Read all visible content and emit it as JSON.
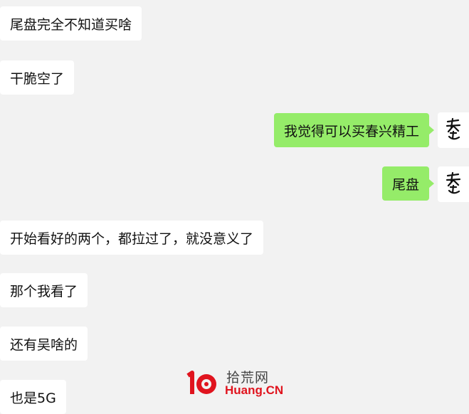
{
  "messages": [
    {
      "side": "left",
      "text": "尾盘完全不知道买啥"
    },
    {
      "side": "left",
      "text": "干脆空了"
    },
    {
      "side": "right",
      "text": "我觉得可以买春兴精工"
    },
    {
      "side": "right",
      "text": "尾盘"
    },
    {
      "side": "left",
      "text": "开始看好的两个，都拉过了，就没意义了"
    },
    {
      "side": "left",
      "text": "那个我看了"
    },
    {
      "side": "left",
      "text": "还有吴啥的"
    },
    {
      "side": "left",
      "text": "也是5G"
    }
  ],
  "watermark": {
    "cn": "拾荒网",
    "en": "Huang.CN",
    "logo_icon": "10-huang-logo-icon"
  },
  "avatar_icon": "calligraphy-avatar-icon",
  "colors": {
    "background": "#f2f2f2",
    "incoming_bubble": "#ffffff",
    "outgoing_bubble": "#95ec69",
    "watermark_red": "#e0141e"
  }
}
